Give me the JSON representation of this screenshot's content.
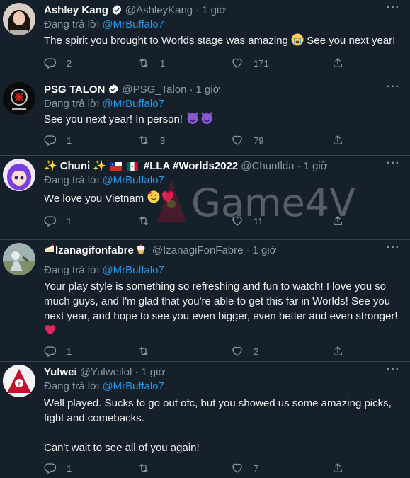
{
  "reply_prefix": "Đang trả lời",
  "watermark": "Game4V",
  "tweets": [
    {
      "name": "Ashley Kang",
      "handle": "@AshleyKang",
      "dot": "·",
      "time": "1 giờ",
      "reply_to": "@MrBuffalo7",
      "lines": [
        "The spirit you brought to Worlds stage was amazing"
      ],
      "text_suffix": "See you next year!",
      "replies": "2",
      "retweets": "1",
      "likes": "171"
    },
    {
      "name": "PSG TALON",
      "handle": "@PSG_Talon",
      "dot": "·",
      "time": "1 giờ",
      "reply_to": "@MrBuffalo7",
      "lines": [
        "See you next year! In person!"
      ],
      "replies": "1",
      "retweets": "3",
      "likes": "79"
    },
    {
      "name_sparkle": "✨",
      "name": "Chuni",
      "name_tags": "#LLA #Worlds2022",
      "handle": "@ChunIlda",
      "dot": "·",
      "time": "1 giờ",
      "reply_to": "@MrBuffalo7",
      "lines": [
        "We love you Vietnam"
      ],
      "replies": "1",
      "retweets": "",
      "likes": "11"
    },
    {
      "name": "Izanagifonfabre",
      "handle": "@IzanagiFonFabre",
      "dot": "·",
      "time": "1 giờ",
      "reply_to": "@MrBuffalo7",
      "lines": [
        "Your play style is something so refreshing and fun to watch! I love you so",
        "much guys, and I'm glad that you're able to get this far in Worlds! See you",
        "next year, and hope to see you even bigger, even better and even stronger!"
      ],
      "replies": "1",
      "retweets": "",
      "likes": "2"
    },
    {
      "name": "Yulwei",
      "handle": "@Yulweilol",
      "dot": "·",
      "time": "1 giờ",
      "reply_to": "@MrBuffalo7",
      "lines": [
        "Well played. Sucks to go out ofc, but you showed us some amazing picks,",
        "fight and comebacks.",
        "Can't wait to see all of you again!"
      ],
      "replies": "1",
      "retweets": "",
      "likes": "7"
    }
  ],
  "colors": {
    "background": "#15202b",
    "link": "#1d9bf0",
    "muted": "#8b98a5",
    "divider": "#38444d",
    "verified": "#ffffff",
    "heart": "#f4212e"
  },
  "icons": [
    "reply-icon",
    "retweet-icon",
    "like-icon",
    "share-icon",
    "more-icon",
    "verified-badge-icon"
  ]
}
